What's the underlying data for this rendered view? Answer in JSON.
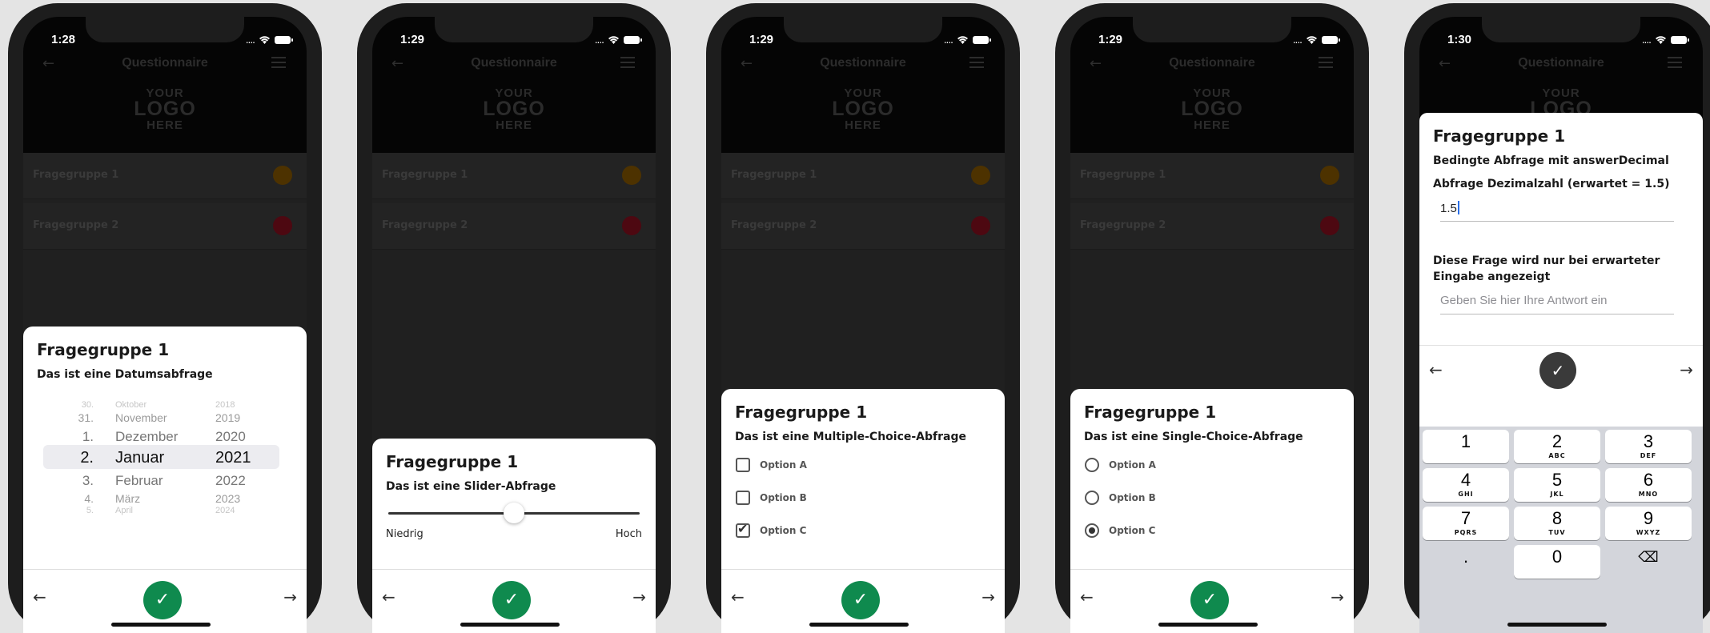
{
  "appbar": {
    "title": "Questionnaire",
    "logo": [
      "YOUR",
      "LOGO",
      "HERE"
    ]
  },
  "groups": [
    "Fragegruppe 1",
    "Fragegruppe 2"
  ],
  "screens": [
    {
      "time": "1:28",
      "sheet_title": "Fragegruppe 1",
      "question": "Das ist eine Datumsabfrage",
      "picker": {
        "rows": [
          [
            "30.",
            "Oktober",
            "2018"
          ],
          [
            "31.",
            "November",
            "2019"
          ],
          [
            "1.",
            "Dezember",
            "2020"
          ],
          [
            "2.",
            "Januar",
            "2021"
          ],
          [
            "3.",
            "Februar",
            "2022"
          ],
          [
            "4.",
            "März",
            "2023"
          ],
          [
            "5.",
            "April",
            "2024"
          ]
        ]
      }
    },
    {
      "time": "1:29",
      "sheet_title": "Fragegruppe 1",
      "question": "Das ist eine Slider-Abfrage",
      "slider": {
        "min_label": "Niedrig",
        "max_label": "Hoch",
        "value": 0.5
      }
    },
    {
      "time": "1:29",
      "sheet_title": "Fragegruppe 1",
      "question": "Das ist eine Multiple-Choice-Abfrage",
      "options": [
        {
          "label": "Option A",
          "checked": false
        },
        {
          "label": "Option B",
          "checked": false
        },
        {
          "label": "Option C",
          "checked": true
        }
      ]
    },
    {
      "time": "1:29",
      "sheet_title": "Fragegruppe 1",
      "question": "Das ist eine Single-Choice-Abfrage",
      "options": [
        {
          "label": "Option A",
          "checked": false
        },
        {
          "label": "Option B",
          "checked": false
        },
        {
          "label": "Option C",
          "checked": true
        }
      ]
    },
    {
      "time": "1:30",
      "sheet_title": "Fragegruppe 1",
      "question": "Bedingte Abfrage mit answerDecimal",
      "sub_question": "Abfrage Dezimalzahl (erwartet = 1.5)",
      "input_value": "1.5",
      "conditional_question": [
        "Diese Frage wird nur bei erwarteter",
        "Eingabe angezeigt"
      ],
      "placeholder": "Geben Sie hier Ihre Antwort ein",
      "keys": [
        {
          "d": "1",
          "s": ""
        },
        {
          "d": "2",
          "s": "ABC"
        },
        {
          "d": "3",
          "s": "DEF"
        },
        {
          "d": "4",
          "s": "GHI"
        },
        {
          "d": "5",
          "s": "JKL"
        },
        {
          "d": "6",
          "s": "MNO"
        },
        {
          "d": "7",
          "s": "PQRS"
        },
        {
          "d": "8",
          "s": "TUV"
        },
        {
          "d": "9",
          "s": "WXYZ"
        },
        {
          "d": ".",
          "s": ""
        },
        {
          "d": "0",
          "s": ""
        },
        {
          "d": "⌫",
          "s": ""
        }
      ]
    }
  ],
  "nav": {
    "prev": "←",
    "next": "→",
    "confirm": "✓"
  },
  "status_signal": "...."
}
